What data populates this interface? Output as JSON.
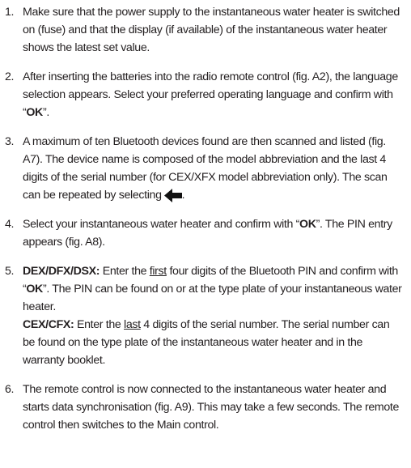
{
  "steps": [
    {
      "num": "1.",
      "text": "Make sure that the power supply to the instantaneous water heater is switched on (fuse) and that the display (if available) of the instantaneous water heater shows the latest set value."
    },
    {
      "num": "2.",
      "pre": "After inserting the batteries into the radio remote control (fig. A2), the language selection appears. Select your preferred operating language and confirm with “",
      "ok": "OK",
      "post": "”."
    },
    {
      "num": "3.",
      "pre": "A maximum of ten Bluetooth devices found are then scanned and listed (fig. A7). The device name is composed of the model abbreviation and the last 4 digits of the serial number (for CEX/XFX model abbreviation only). The scan can be repeated by selecting",
      "icon": "back-arrow-icon",
      "post": "."
    },
    {
      "num": "4.",
      "pre": "Select your instantaneous water heater and confirm with “",
      "ok": "OK",
      "post": "”. The PIN entry appears (fig. A8)."
    },
    {
      "num": "5.",
      "a_model": "DEX/DFX/DSX:",
      "a_pre": " Enter the ",
      "a_u": "first",
      "a_mid": " four digits of the Bluetooth PIN and confirm with “",
      "a_ok": "OK",
      "a_post": "”. The PIN can be found on or at the type plate of your instantaneous water heater.",
      "b_model": "CEX/CFX:",
      "b_pre": " Enter the ",
      "b_u": "last",
      "b_post": " 4 digits of the serial number. The serial number can be found on the type plate of the instantaneous water heater and in the warranty booklet."
    },
    {
      "num": "6.",
      "text": "The remote control is now connected to the instantaneous water heater and starts data synchronisation (fig. A9). This may take a few seconds. The remote control then switches to the Main control."
    }
  ]
}
